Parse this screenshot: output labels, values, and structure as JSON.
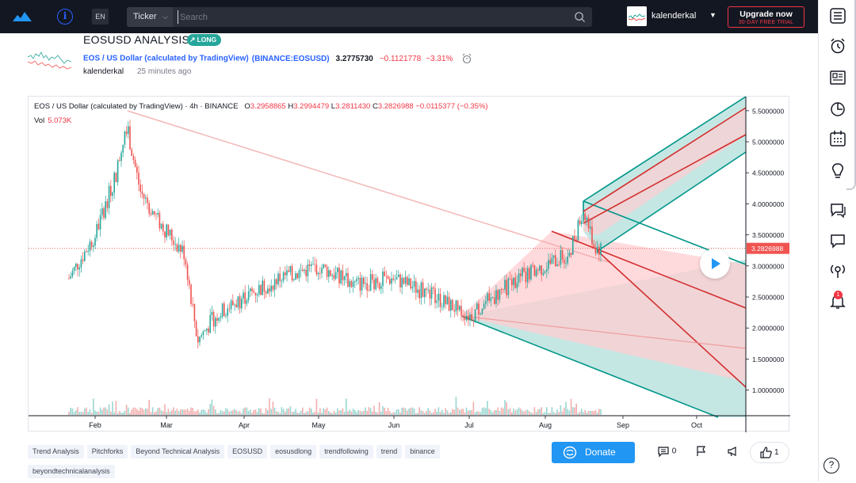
{
  "topbar": {
    "logo": "tradingview-cloud-logo",
    "info_icon": "i",
    "language": "EN",
    "ticker_label": "Ticker",
    "search_placeholder": "Search",
    "username": "kalenderkal",
    "upgrade_title": "Upgrade now",
    "upgrade_sub": "30-DAY FREE TRIAL"
  },
  "idea": {
    "title": "EOSUSD ANALYSIS",
    "badge": "LONG",
    "symbol_name": "EOS / US Dollar (calculated by TradingView)",
    "symbol_source": "(BINANCE:EOSUSD)",
    "price": "3.2775730",
    "change": "−0.1121778",
    "change_pct": "−3.31%",
    "author": "kalenderkal",
    "posted": "25 minutes ago"
  },
  "chart": {
    "legend_title": "EOS / US Dollar (calculated by TradingView) · 4h · BINANCE",
    "legend_o": "3.2958865",
    "legend_h": "3.2994479",
    "legend_l": "3.2811430",
    "legend_c": "3.2826988",
    "legend_chg": "−0.0115377 (−0.35%)",
    "volume_label": "Vol",
    "volume_value": "5.073K",
    "last_price_label": "3.2826988",
    "price_axis": [
      "5.5000000",
      "5.0000000",
      "4.5000000",
      "4.0000000",
      "3.5000000",
      "3.0000000",
      "2.5000000",
      "2.0000000",
      "1.5000000",
      "1.0000000"
    ],
    "time_axis": [
      "Feb",
      "Mar",
      "Apr",
      "May",
      "Jun",
      "Jul",
      "Aug",
      "Sep",
      "Oct"
    ],
    "colors": {
      "up": "#26a69a",
      "down": "#ef5350",
      "pitchfork_teal": "#009688",
      "pitchfork_red": "#d32f2f",
      "fill_teal": "#b2dfdb",
      "fill_red": "#ffcdd2"
    }
  },
  "chart_data": {
    "type": "candlestick",
    "title": "EOS / US Dollar (calculated by TradingView) · 4h · BINANCE",
    "x_ticks": [
      "Feb",
      "Mar",
      "Apr",
      "May",
      "Jun",
      "Jul",
      "Aug",
      "Sep",
      "Oct"
    ],
    "y_ticks": [
      5.5,
      5.0,
      4.5,
      4.0,
      3.5,
      3.0,
      2.5,
      2.0,
      1.5,
      1.0
    ],
    "ylim": [
      0.6,
      5.6
    ],
    "last_price": 3.2826988,
    "approx_path": {
      "x": [
        "Jan 20",
        "Feb 1",
        "Feb 10",
        "Feb 14",
        "Feb 20",
        "Feb 28",
        "Mar 8",
        "Mar 13",
        "Mar 20",
        "Apr 1",
        "Apr 15",
        "May 1",
        "May 15",
        "Jun 1",
        "Jun 15",
        "Jul 1",
        "Jul 20",
        "Aug 1",
        "Aug 10",
        "Aug 16",
        "Aug 20",
        "Aug 23"
      ],
      "y": [
        2.8,
        3.5,
        4.5,
        5.3,
        4.2,
        3.7,
        3.2,
        1.8,
        2.2,
        2.5,
        2.8,
        3.0,
        2.7,
        2.8,
        2.55,
        2.2,
        2.8,
        3.0,
        3.2,
        3.9,
        3.3,
        3.28
      ]
    }
  },
  "tags": [
    "Trend Analysis",
    "Pitchforks",
    "Beyond Technical Analysis",
    "EOSUSD",
    "eosusdlong",
    "trendfollowing",
    "trend",
    "binance",
    "beyondtechnicalanalysis"
  ],
  "actions": {
    "donate": "Donate",
    "comments": "0",
    "likes": "1"
  },
  "rightbar": {
    "notification_count": "1",
    "icons": [
      "watchlist-icon",
      "alarm-clock-icon",
      "news-icon",
      "data-window-icon",
      "calendar-icon",
      "ideas-lightbulb-icon",
      "chats-icon",
      "private-chat-icon",
      "streams-icon",
      "notifications-bell-icon",
      "help-icon"
    ]
  }
}
